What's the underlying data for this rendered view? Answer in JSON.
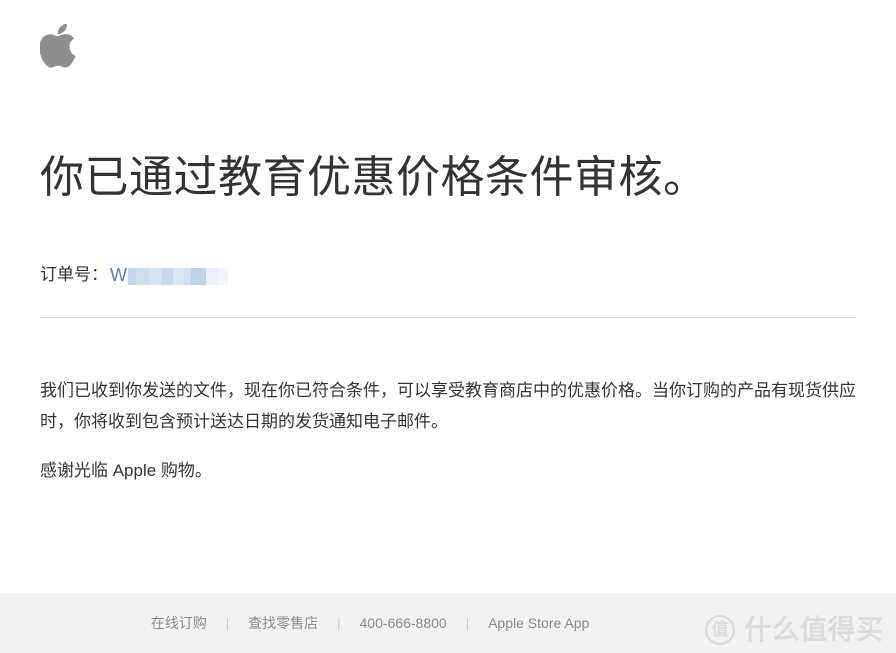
{
  "brand": {
    "logo_icon": "apple-logo-icon",
    "logo_color": "#8e8e8e"
  },
  "main": {
    "headline": "你已通过教育优惠价格条件审核。",
    "order": {
      "label": "订单号：",
      "value_prefix": "W",
      "value_redacted": true,
      "link_color": "#4a7fc1"
    },
    "paragraphs": [
      "我们已收到你发送的文件，现在你已符合条件，可以享受教育商店中的优惠价格。当你订购的产品有现货供应时，你将收到包含预计送达日期的发货通知电子邮件。",
      "感谢光临 Apple 购物。"
    ]
  },
  "footer": {
    "background": "#f2f2f2",
    "text_color": "#8a8a8f",
    "separator": "|",
    "links": [
      {
        "label": "在线订购"
      },
      {
        "label": "查找零售店"
      },
      {
        "label": "400-666-8800"
      },
      {
        "label": "Apple Store App"
      }
    ]
  },
  "watermark": {
    "badge": "值",
    "text": "什么值得买",
    "color": "#dcdcdc"
  }
}
